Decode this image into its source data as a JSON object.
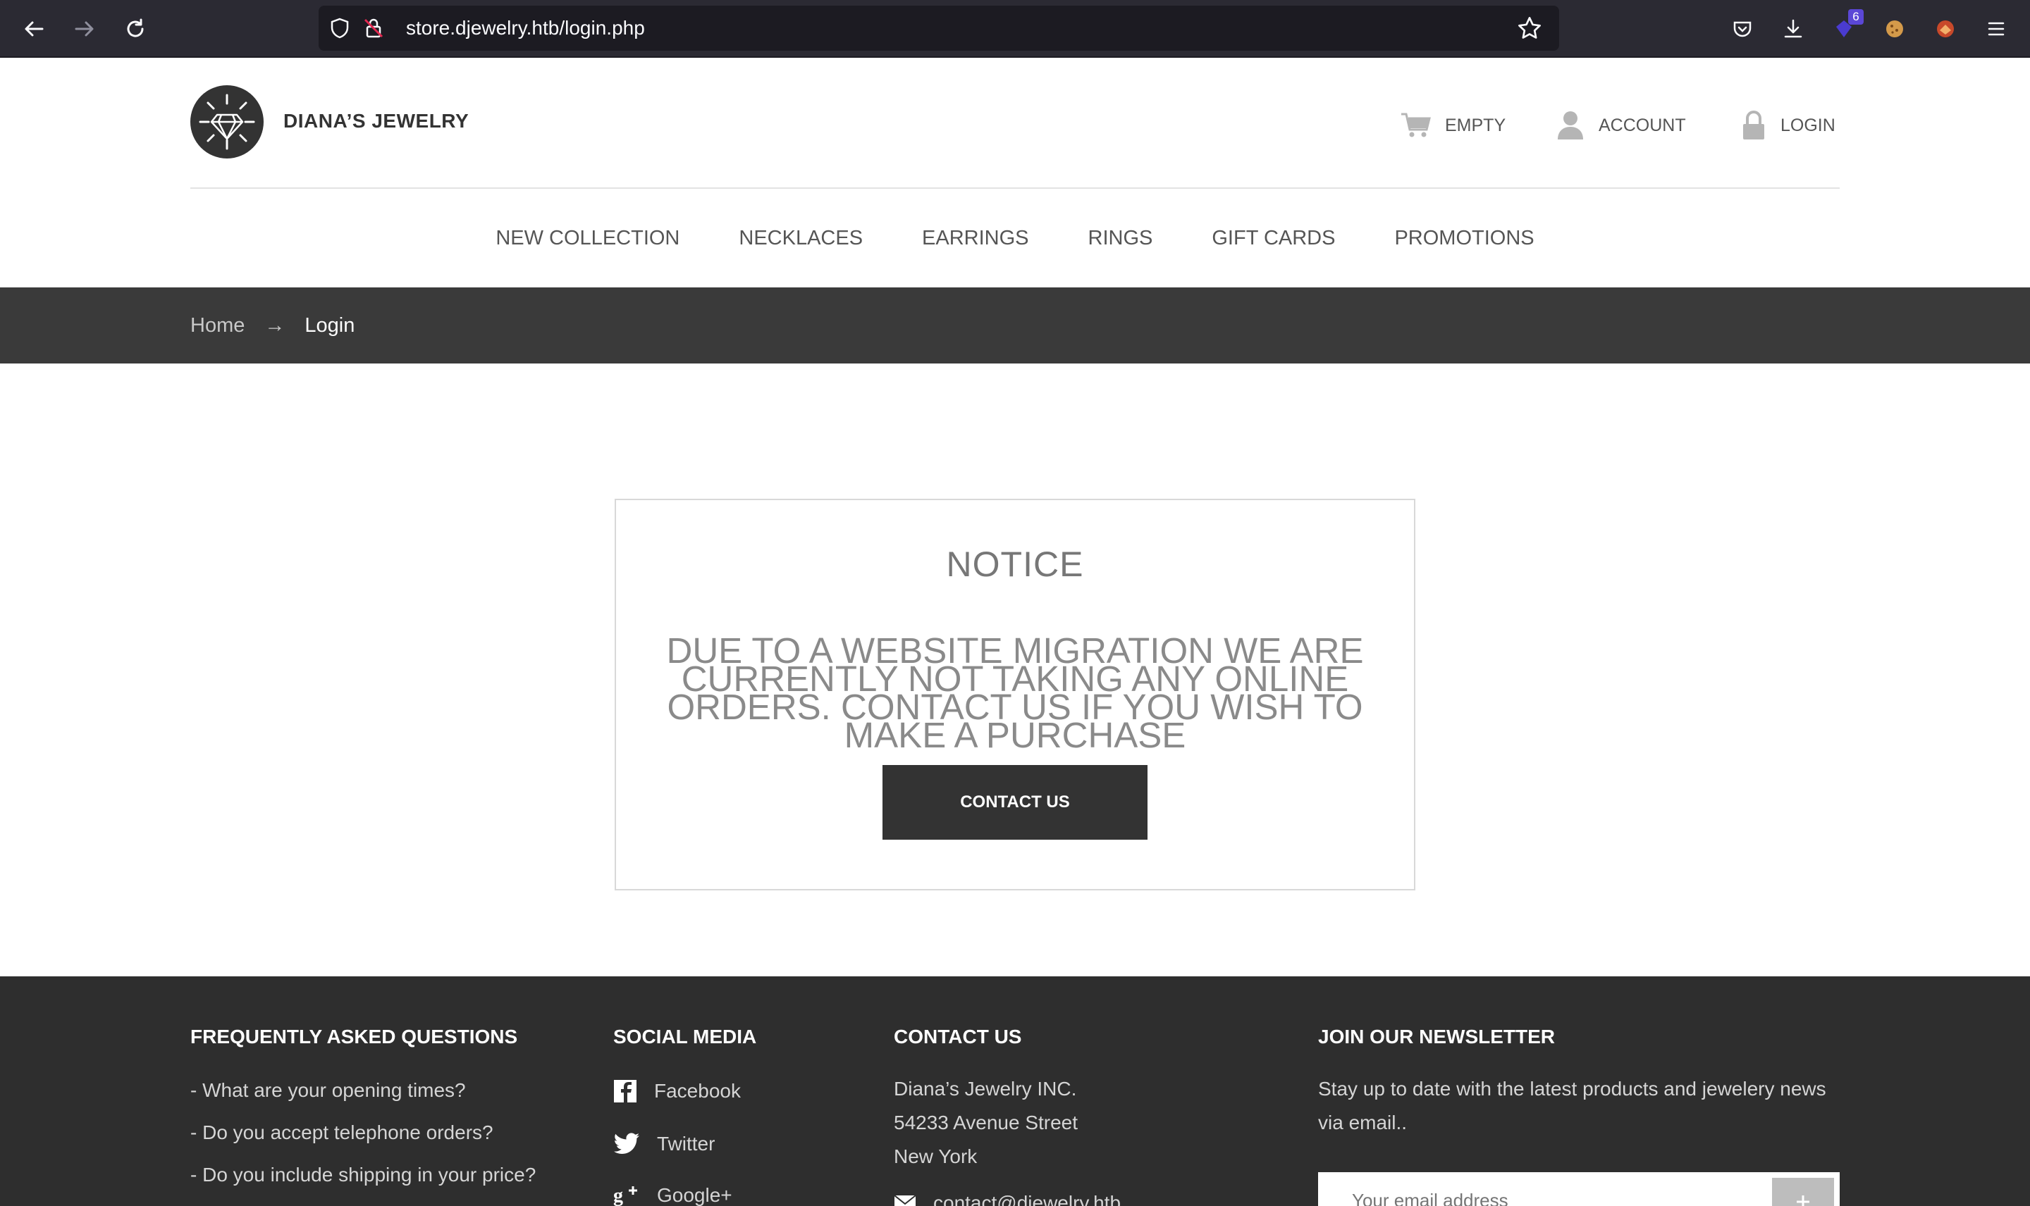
{
  "browser": {
    "url": "store.djewelry.htb/login.php",
    "extension_badge": "6"
  },
  "header": {
    "logo_text": "DIANA’S JEWELRY",
    "cart_label": "EMPTY",
    "account_label": "ACCOUNT",
    "login_label": "LOGIN"
  },
  "nav": {
    "items": [
      "NEW COLLECTION",
      "NECKLACES",
      "EARRINGS",
      "RINGS",
      "GIFT CARDS",
      "PROMOTIONS"
    ]
  },
  "breadcrumb": {
    "home": "Home",
    "separator": "→",
    "current": "Login"
  },
  "notice": {
    "title": "NOTICE",
    "body": "DUE TO A WEBSITE MIGRATION WE ARE CURRENTLY NOT TAKING ANY ONLINE ORDERS. CONTACT US IF YOU WISH TO MAKE A PURCHASE",
    "button_label": "CONTACT US"
  },
  "footer": {
    "faq": {
      "heading": "FREQUENTLY ASKED QUESTIONS",
      "items": [
        "- What are your opening times?",
        "- Do you accept telephone orders?",
        "- Do you include shipping in your price?"
      ]
    },
    "social": {
      "heading": "SOCIAL MEDIA",
      "items": [
        "Facebook",
        "Twitter",
        "Google+"
      ]
    },
    "contact": {
      "heading": "CONTACT US",
      "company": "Diana’s Jewelry INC.",
      "street": "54233 Avenue Street",
      "city": "New York",
      "email": "contact@djewelry.htb"
    },
    "newsletter": {
      "heading": "JOIN OUR NEWSLETTER",
      "line1": "Stay up to date with the latest products and jewelery news",
      "line2": "via email..",
      "placeholder": "Your email address"
    }
  },
  "colors": {
    "chrome_bg": "#2b2a33",
    "dark": "#333333",
    "breadcrumb_bg": "#3a3a3a",
    "footer_bg": "#2e2e2e"
  }
}
